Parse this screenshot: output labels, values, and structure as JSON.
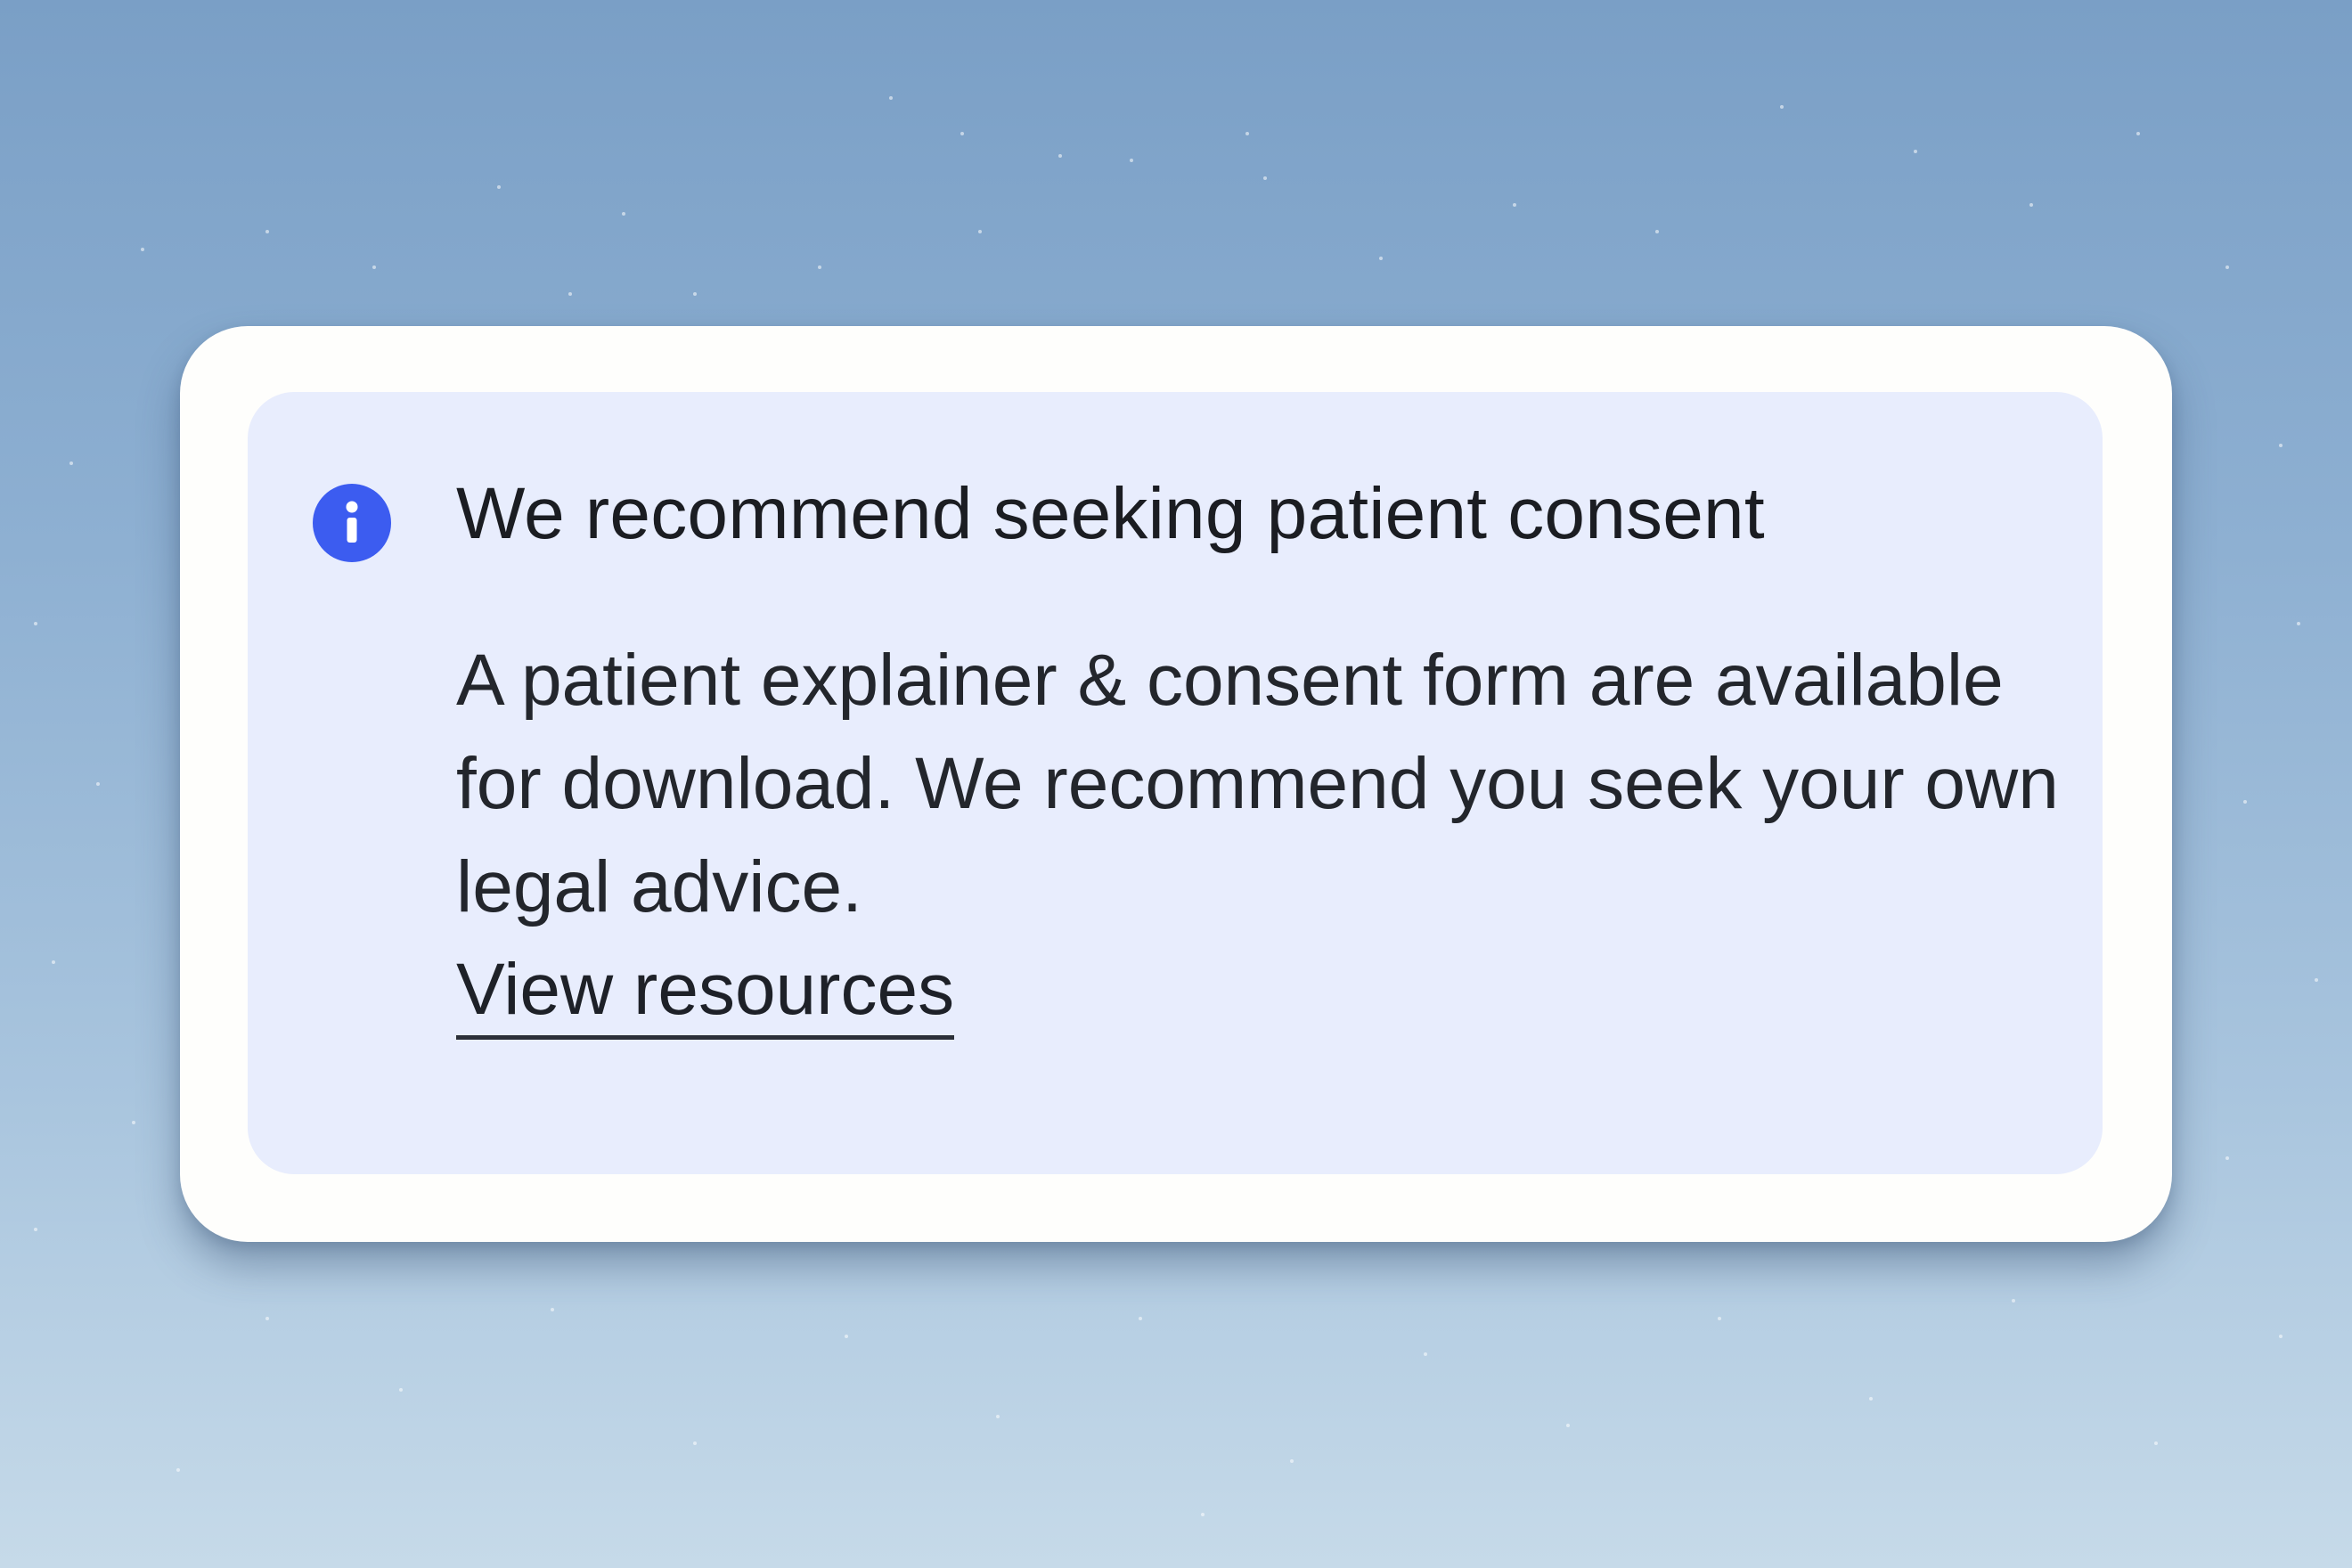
{
  "notice": {
    "icon": "info-icon",
    "title": "We recommend seeking patient consent",
    "body": "A patient explainer & consent form are available for download. We recommend you seek your own legal advice.",
    "link_label": "View resources"
  },
  "colors": {
    "background_top": "#7a9fc6",
    "background_bottom": "#c6dae9",
    "card": "#fefefc",
    "callout": "#e8edfd",
    "icon": "#3c5cf0",
    "text": "#1b1d22"
  }
}
